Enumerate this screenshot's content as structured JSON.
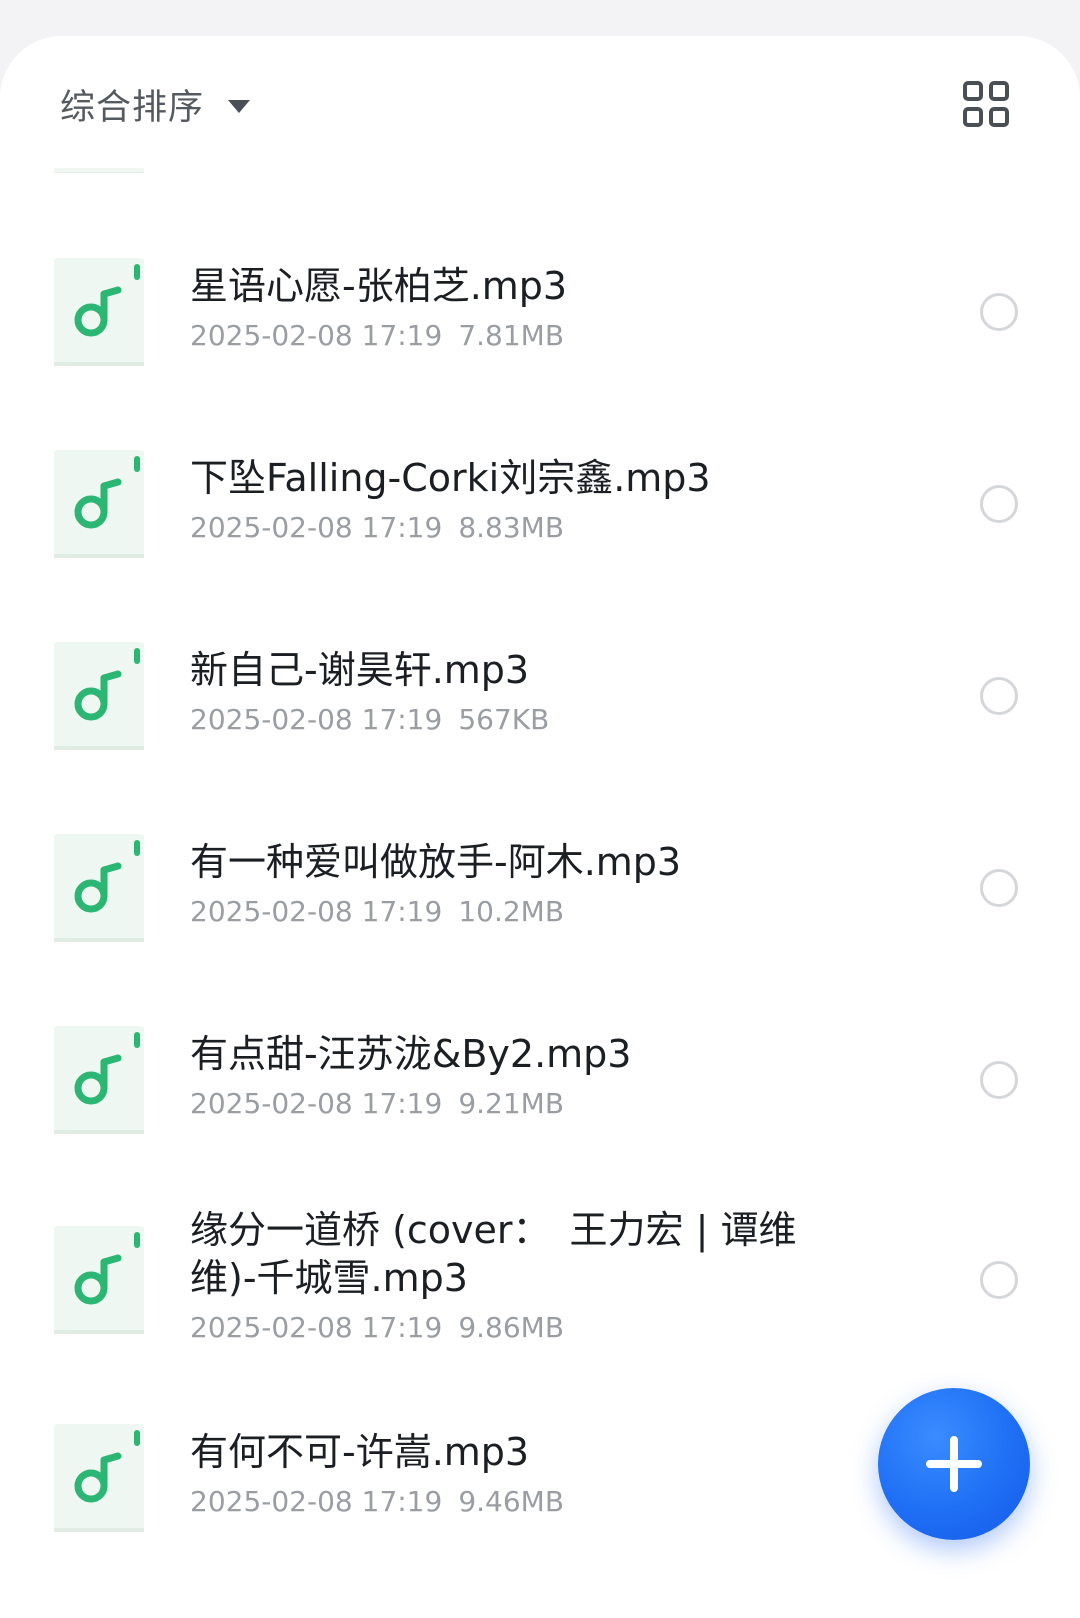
{
  "toolbar": {
    "sort_label": "综合排序",
    "sort_icon": "caret-down-icon",
    "view_toggle_icon": "grid-view-icon"
  },
  "files": [
    {
      "name": "星语心愿-张柏芝.mp3",
      "date": "2025-02-08 17:19",
      "size": "7.81MB",
      "icon": "music-file-icon"
    },
    {
      "name": "下坠Falling-Corki刘宗鑫.mp3",
      "date": "2025-02-08 17:19",
      "size": "8.83MB",
      "icon": "music-file-icon"
    },
    {
      "name": "新自己-谢昊轩.mp3",
      "date": "2025-02-08 17:19",
      "size": "567KB",
      "icon": "music-file-icon"
    },
    {
      "name": "有一种爱叫做放手-阿木.mp3",
      "date": "2025-02-08 17:19",
      "size": "10.2MB",
      "icon": "music-file-icon"
    },
    {
      "name": "有点甜-汪苏泷&By2.mp3",
      "date": "2025-02-08 17:19",
      "size": "9.21MB",
      "icon": "music-file-icon"
    },
    {
      "name": "缘分一道桥 (cover：　王力宏 | 谭维维)-千城雪.mp3",
      "date": "2025-02-08 17:19",
      "size": "9.86MB",
      "icon": "music-file-icon"
    },
    {
      "name": "有何不可-许嵩.mp3",
      "date": "2025-02-08 17:19",
      "size": "9.46MB",
      "icon": "music-file-icon"
    }
  ],
  "fab": {
    "icon": "plus-icon"
  },
  "colors": {
    "accent": "#1f6ff5",
    "music_green": "#2bb673",
    "thumb_bg": "#eef7f1",
    "text_primary": "#1b1e22",
    "text_secondary": "#9a9ea3"
  }
}
